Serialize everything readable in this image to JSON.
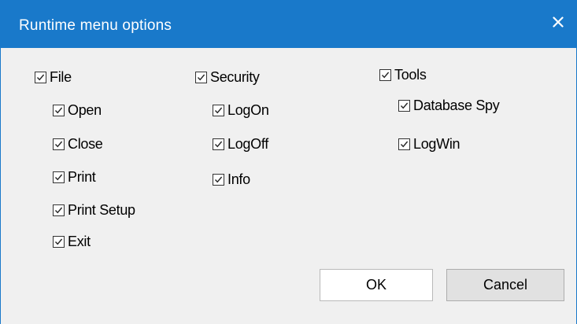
{
  "dialog": {
    "title": "Runtime menu options",
    "close_glyph": "✕",
    "accent_color": "#1979ca"
  },
  "options": {
    "file": {
      "label": "File",
      "checked": true
    },
    "open": {
      "label": "Open",
      "checked": true
    },
    "close": {
      "label": "Close",
      "checked": true
    },
    "print": {
      "label": "Print",
      "checked": true
    },
    "print_setup": {
      "label": "Print Setup",
      "checked": true
    },
    "exit": {
      "label": "Exit",
      "checked": true
    },
    "security": {
      "label": "Security",
      "checked": true
    },
    "logon": {
      "label": "LogOn",
      "checked": true
    },
    "logoff": {
      "label": "LogOff",
      "checked": true
    },
    "info": {
      "label": "Info",
      "checked": true
    },
    "tools": {
      "label": "Tools",
      "checked": true
    },
    "database_spy": {
      "label": "Database Spy",
      "checked": true
    },
    "logwin": {
      "label": "LogWin",
      "checked": true
    }
  },
  "buttons": {
    "ok": "OK",
    "cancel": "Cancel"
  },
  "icons": {
    "close": "close-icon",
    "check": "checkmark-icon"
  }
}
